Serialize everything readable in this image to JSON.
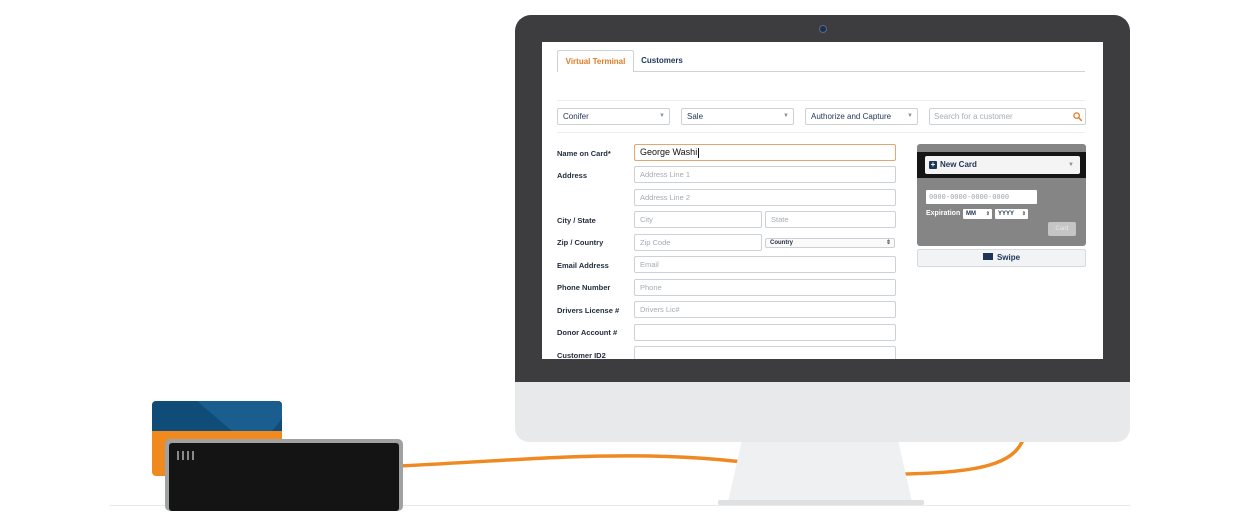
{
  "tabs": [
    {
      "label": "Virtual Terminal",
      "active": true
    },
    {
      "label": "Customers",
      "active": false
    }
  ],
  "toolbar": {
    "organization": "Conifer",
    "transaction_type": "Sale",
    "capture_mode": "Authorize and Capture",
    "search_placeholder": "Search for a customer"
  },
  "form": {
    "name_label": "Name on Card*",
    "name_value": "George Washi",
    "address_label": "Address",
    "address1_placeholder": "Address Line 1",
    "address2_placeholder": "Address Line 2",
    "city_state_label": "City / State",
    "city_placeholder": "City",
    "state_placeholder": "State",
    "zip_country_label": "Zip / Country",
    "zip_placeholder": "Zip Code",
    "country_value": "Country",
    "email_label": "Email Address",
    "email_placeholder": "Email",
    "phone_label": "Phone Number",
    "phone_placeholder": "Phone",
    "license_label": "Drivers License #",
    "license_placeholder": "Drivers Lic#",
    "donor_label": "Donor Account #",
    "customer_label": "Customer ID2"
  },
  "card": {
    "select_label": "New Card",
    "number_placeholder": "0000-0000-0000-0000",
    "expiration_label": "Expiration",
    "month_value": "MM",
    "year_value": "YYYY",
    "submit_label": "Card",
    "swipe_label": "Swipe"
  },
  "colors": {
    "accent": "#e07b27",
    "navy": "#1f3556",
    "bezel": "#3d3d3f",
    "card_blue": "#104c78",
    "card_orange": "#f08a1f"
  }
}
